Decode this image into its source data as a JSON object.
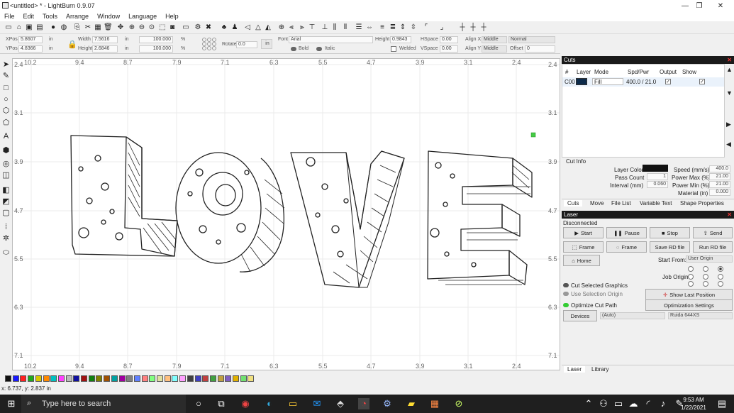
{
  "window": {
    "title": "<untitled> * - LightBurn 0.9.07",
    "minimize": "—",
    "maximize": "❐",
    "close": "✕"
  },
  "menu": [
    "File",
    "Edit",
    "Tools",
    "Arrange",
    "Window",
    "Language",
    "Help"
  ],
  "props": {
    "xpos_label": "XPos",
    "xpos_value": "5.8607",
    "ypos_label": "YPos",
    "ypos_value": "4.8366",
    "pos_unit": "in",
    "width_label": "Width",
    "width_value": "7.5616",
    "height_label": "Height",
    "height_value": "2.6846",
    "size_unit": "in",
    "scale_w": "100.000",
    "scale_h": "100.000",
    "pct": "%",
    "rotate_label": "Rotate",
    "rotate_value": "0.0",
    "in_button": "in",
    "font_label": "Font",
    "font_value": "Arial",
    "height2_label": "Height",
    "height2_value": "0.9843",
    "hspace_label": "HSpace",
    "hspace_value": "0.00",
    "vspace_label": "VSpace",
    "vspace_value": "0.00",
    "alignx_label": "Align X",
    "alignx_value": "Middle",
    "aligny_label": "Align Y",
    "aligny_value": "Middle",
    "normal_value": "Normal",
    "offset_label": "Offset",
    "offset_value": "0",
    "bold": "Bold",
    "italic": "Italic",
    "welded": "Welded"
  },
  "ruler": {
    "top": [
      "10.2",
      "9.4",
      "8.7",
      "7.9",
      "7.1",
      "6.3",
      "5.5",
      "4.7",
      "3.9",
      "3.1",
      "2.4"
    ],
    "left": [
      "2.4",
      "3.1",
      "3.9",
      "4.7",
      "5.5",
      "6.3",
      "7.1"
    ]
  },
  "cuts": {
    "title": "Cuts",
    "headers": [
      "#",
      "Layer",
      "Mode",
      "Spd/Pwr",
      "Output",
      "Show"
    ],
    "row": {
      "num": "C00",
      "layer_color": "#0c2a4a",
      "mode": "Fill",
      "spdpwr": "400.0 / 21.0",
      "output": "✓",
      "show": "✓"
    },
    "cut_info": "Cut Info",
    "layer_color_label": "Layer Color",
    "speed_label": "Speed (mm/s)",
    "speed_value": "400.0",
    "pass_label": "Pass Count",
    "pass_value": "1",
    "powmax_label": "Power Max (%)",
    "powmax_value": "21.00",
    "interval_label": "Interval (mm)",
    "interval_value": "0.060",
    "powmin_label": "Power Min (%)",
    "powmin_value": "21.00",
    "material_label": "Material (in)",
    "material_value": "0.000",
    "tabs": [
      "Cuts",
      "Move",
      "File List",
      "Variable Text",
      "Shape Properties"
    ]
  },
  "laser": {
    "title": "Laser",
    "state": "Disconnected",
    "start": "Start",
    "pause": "Pause",
    "stop": "Stop",
    "send": "Send",
    "frame1": "Frame",
    "frame2": "Frame",
    "save_rd": "Save RD file",
    "run_rd": "Run RD file",
    "home": "Home",
    "start_from_label": "Start From:",
    "start_from_value": "User Origin",
    "job_origin": "Job Origin",
    "cut_selected": "Cut Selected Graphics",
    "use_selection": "Use Selection Origin",
    "show_last": "Show Last Position",
    "optimize": "Optimize Cut Path",
    "opt_settings": "Optimization Settings",
    "devices": "Devices",
    "auto": "(Auto)",
    "device": "Ruida 644XS",
    "tabs": [
      "Laser",
      "Library"
    ]
  },
  "palette": [
    "#111111",
    "#1a1aff",
    "#ff2020",
    "#1fa81f",
    "#d8c800",
    "#ff8800",
    "#00c0c0",
    "#ff40ff",
    "#bbbbbb",
    "#1010a0",
    "#a01010",
    "#108010",
    "#808000",
    "#a05000",
    "#00a0a0",
    "#a000a0",
    "#808080",
    "#6080ff",
    "#ff8080",
    "#80ff80",
    "#e0e0a0",
    "#ffc080",
    "#80ffff",
    "#ffa0ff",
    "#404040",
    "#4040c0",
    "#c04040",
    "#40a040",
    "#c0a040",
    "#8060c0",
    "#e0b000",
    "#70e070",
    "#f0e080"
  ],
  "status": "x: 6.737, y: 2.837 in",
  "taskbar": {
    "search": "Type here to search",
    "time": "9:53 AM",
    "date": "1/22/2021"
  }
}
